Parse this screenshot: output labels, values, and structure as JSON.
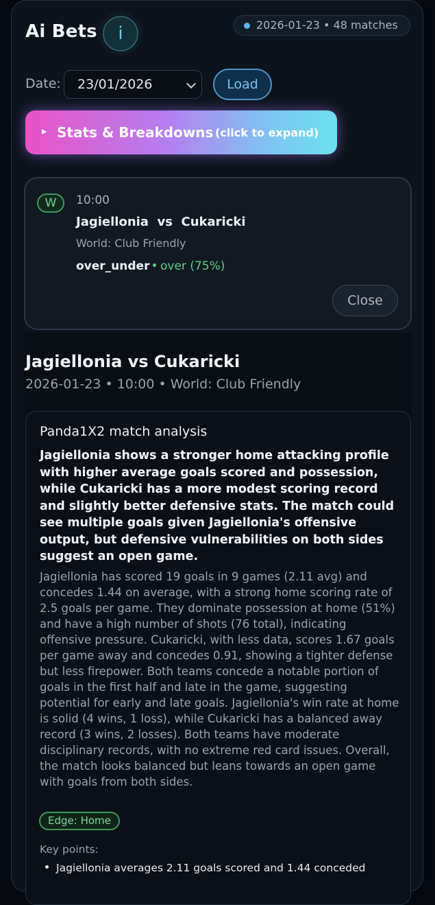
{
  "header": {
    "title": "Ai Bets",
    "info_label": "i",
    "status": "2026-01-23 • 48 matches",
    "status_dot_color": "#5ab4f0"
  },
  "date_row": {
    "label": "Date:",
    "selected": "23/01/2026",
    "load_label": "Load"
  },
  "stats_banner": {
    "title": "Stats & Breakdowns",
    "hint": "(click to expand)"
  },
  "bet_card": {
    "badge": "W",
    "time": "10:00",
    "home": "Jagiellonia",
    "vs": "vs",
    "away": "Cukaricki",
    "league": "World: Club Friendly",
    "market": "over_under",
    "pick": "over (75%)",
    "close_label": "Close",
    "pick_color": "#5fd07f"
  },
  "detail": {
    "title": "Jagiellonia vs Cukaricki",
    "meta": "2026-01-23 • 10:00 • World: Club Friendly",
    "analysis_heading": "Panda1X2 match analysis",
    "summary": "Jagiellonia shows a stronger home attacking profile with higher average goals scored and possession, while Cukaricki has a more modest scoring record and slightly better defensive stats. The match could see multiple goals given Jagiellonia's offensive output, but defensive vulnerabilities on both sides suggest an open game.",
    "body": "Jagiellonia has scored 19 goals in 9 games (2.11 avg) and concedes 1.44 on average, with a strong home scoring rate of 2.5 goals per game. They dominate possession at home (51%) and have a high number of shots (76 total), indicating offensive pressure. Cukaricki, with less data, scores 1.67 goals per game away and concedes 0.91, showing a tighter defense but less firepower. Both teams concede a notable portion of goals in the first half and late in the game, suggesting potential for early and late goals. Jagiellonia's win rate at home is solid (4 wins, 1 loss), while Cukaricki has a balanced away record (3 wins, 2 losses). Both teams have moderate disciplinary records, with no extreme red card issues. Overall, the match looks balanced but leans towards an open game with goals from both sides.",
    "edge": "Edge: Home",
    "key_points_label": "Key points:",
    "key_points": [
      "Jagiellonia averages 2.11 goals scored and 1.44 conceded"
    ]
  }
}
